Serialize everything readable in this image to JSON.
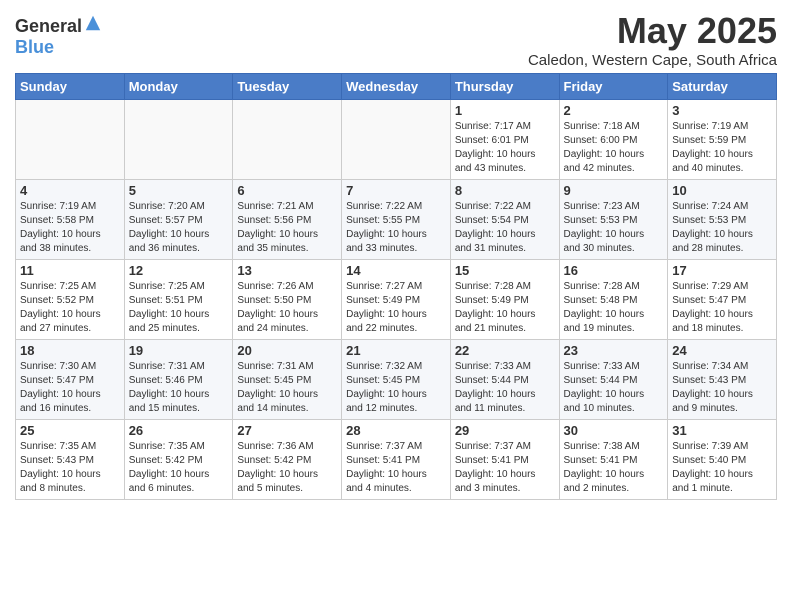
{
  "header": {
    "logo_general": "General",
    "logo_blue": "Blue",
    "month_title": "May 2025",
    "subtitle": "Caledon, Western Cape, South Africa"
  },
  "weekdays": [
    "Sunday",
    "Monday",
    "Tuesday",
    "Wednesday",
    "Thursday",
    "Friday",
    "Saturday"
  ],
  "weeks": [
    [
      {
        "day": "",
        "info": ""
      },
      {
        "day": "",
        "info": ""
      },
      {
        "day": "",
        "info": ""
      },
      {
        "day": "",
        "info": ""
      },
      {
        "day": "1",
        "info": "Sunrise: 7:17 AM\nSunset: 6:01 PM\nDaylight: 10 hours\nand 43 minutes."
      },
      {
        "day": "2",
        "info": "Sunrise: 7:18 AM\nSunset: 6:00 PM\nDaylight: 10 hours\nand 42 minutes."
      },
      {
        "day": "3",
        "info": "Sunrise: 7:19 AM\nSunset: 5:59 PM\nDaylight: 10 hours\nand 40 minutes."
      }
    ],
    [
      {
        "day": "4",
        "info": "Sunrise: 7:19 AM\nSunset: 5:58 PM\nDaylight: 10 hours\nand 38 minutes."
      },
      {
        "day": "5",
        "info": "Sunrise: 7:20 AM\nSunset: 5:57 PM\nDaylight: 10 hours\nand 36 minutes."
      },
      {
        "day": "6",
        "info": "Sunrise: 7:21 AM\nSunset: 5:56 PM\nDaylight: 10 hours\nand 35 minutes."
      },
      {
        "day": "7",
        "info": "Sunrise: 7:22 AM\nSunset: 5:55 PM\nDaylight: 10 hours\nand 33 minutes."
      },
      {
        "day": "8",
        "info": "Sunrise: 7:22 AM\nSunset: 5:54 PM\nDaylight: 10 hours\nand 31 minutes."
      },
      {
        "day": "9",
        "info": "Sunrise: 7:23 AM\nSunset: 5:53 PM\nDaylight: 10 hours\nand 30 minutes."
      },
      {
        "day": "10",
        "info": "Sunrise: 7:24 AM\nSunset: 5:53 PM\nDaylight: 10 hours\nand 28 minutes."
      }
    ],
    [
      {
        "day": "11",
        "info": "Sunrise: 7:25 AM\nSunset: 5:52 PM\nDaylight: 10 hours\nand 27 minutes."
      },
      {
        "day": "12",
        "info": "Sunrise: 7:25 AM\nSunset: 5:51 PM\nDaylight: 10 hours\nand 25 minutes."
      },
      {
        "day": "13",
        "info": "Sunrise: 7:26 AM\nSunset: 5:50 PM\nDaylight: 10 hours\nand 24 minutes."
      },
      {
        "day": "14",
        "info": "Sunrise: 7:27 AM\nSunset: 5:49 PM\nDaylight: 10 hours\nand 22 minutes."
      },
      {
        "day": "15",
        "info": "Sunrise: 7:28 AM\nSunset: 5:49 PM\nDaylight: 10 hours\nand 21 minutes."
      },
      {
        "day": "16",
        "info": "Sunrise: 7:28 AM\nSunset: 5:48 PM\nDaylight: 10 hours\nand 19 minutes."
      },
      {
        "day": "17",
        "info": "Sunrise: 7:29 AM\nSunset: 5:47 PM\nDaylight: 10 hours\nand 18 minutes."
      }
    ],
    [
      {
        "day": "18",
        "info": "Sunrise: 7:30 AM\nSunset: 5:47 PM\nDaylight: 10 hours\nand 16 minutes."
      },
      {
        "day": "19",
        "info": "Sunrise: 7:31 AM\nSunset: 5:46 PM\nDaylight: 10 hours\nand 15 minutes."
      },
      {
        "day": "20",
        "info": "Sunrise: 7:31 AM\nSunset: 5:45 PM\nDaylight: 10 hours\nand 14 minutes."
      },
      {
        "day": "21",
        "info": "Sunrise: 7:32 AM\nSunset: 5:45 PM\nDaylight: 10 hours\nand 12 minutes."
      },
      {
        "day": "22",
        "info": "Sunrise: 7:33 AM\nSunset: 5:44 PM\nDaylight: 10 hours\nand 11 minutes."
      },
      {
        "day": "23",
        "info": "Sunrise: 7:33 AM\nSunset: 5:44 PM\nDaylight: 10 hours\nand 10 minutes."
      },
      {
        "day": "24",
        "info": "Sunrise: 7:34 AM\nSunset: 5:43 PM\nDaylight: 10 hours\nand 9 minutes."
      }
    ],
    [
      {
        "day": "25",
        "info": "Sunrise: 7:35 AM\nSunset: 5:43 PM\nDaylight: 10 hours\nand 8 minutes."
      },
      {
        "day": "26",
        "info": "Sunrise: 7:35 AM\nSunset: 5:42 PM\nDaylight: 10 hours\nand 6 minutes."
      },
      {
        "day": "27",
        "info": "Sunrise: 7:36 AM\nSunset: 5:42 PM\nDaylight: 10 hours\nand 5 minutes."
      },
      {
        "day": "28",
        "info": "Sunrise: 7:37 AM\nSunset: 5:41 PM\nDaylight: 10 hours\nand 4 minutes."
      },
      {
        "day": "29",
        "info": "Sunrise: 7:37 AM\nSunset: 5:41 PM\nDaylight: 10 hours\nand 3 minutes."
      },
      {
        "day": "30",
        "info": "Sunrise: 7:38 AM\nSunset: 5:41 PM\nDaylight: 10 hours\nand 2 minutes."
      },
      {
        "day": "31",
        "info": "Sunrise: 7:39 AM\nSunset: 5:40 PM\nDaylight: 10 hours\nand 1 minute."
      }
    ]
  ]
}
